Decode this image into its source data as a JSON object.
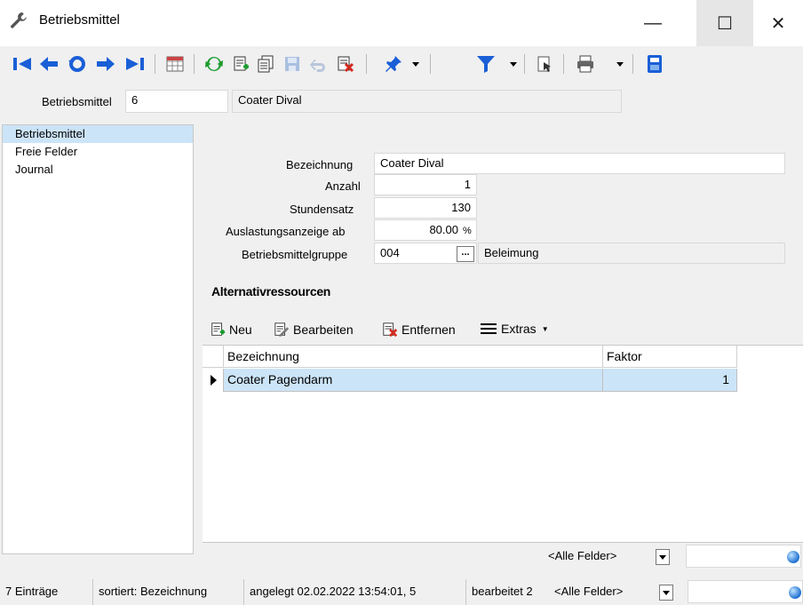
{
  "window": {
    "title": "Betriebsmittel",
    "minimize": "—",
    "maximize": "☐",
    "close": "✕"
  },
  "header": {
    "label": "Betriebsmittel",
    "number": "6",
    "name": "Coater Dival"
  },
  "nav": {
    "items": [
      "Betriebsmittel",
      "Freie Felder",
      "Journal"
    ],
    "selected": 0
  },
  "form": {
    "bezeichnung": {
      "label": "Bezeichnung",
      "value": "Coater Dival"
    },
    "anzahl": {
      "label": "Anzahl",
      "value": "1"
    },
    "stundensatz": {
      "label": "Stundensatz",
      "value": "130"
    },
    "auslastung": {
      "label": "Auslastungsanzeige ab",
      "value": "80.00",
      "unit": "%"
    },
    "gruppe": {
      "label": "Betriebsmittelgruppe",
      "code": "004",
      "button": "...",
      "name": "Beleimung"
    }
  },
  "alternatives": {
    "title": "Alternativressourcen",
    "toolbar": {
      "neu": "Neu",
      "bearbeiten": "Bearbeiten",
      "entfernen": "Entfernen",
      "extras": "Extras"
    },
    "columns": [
      "Bezeichnung",
      "Faktor"
    ],
    "rows": [
      {
        "bezeichnung": "Coater Pagendarm",
        "faktor": "1"
      }
    ],
    "filter": "<Alle Felder>"
  },
  "status": {
    "count": "7 Einträge",
    "sort": "sortiert: Bezeichnung",
    "created": "angelegt 02.02.2022 13:54:01, 5",
    "edited": "bearbeitet 2",
    "filter": "<Alle Felder>"
  },
  "colors": {
    "selection": "#cce4f7",
    "nav_icon_blue": "#1a5fd6",
    "refresh_green": "#1c9b2e",
    "delete_red": "#d42a1e"
  },
  "icons": [
    "wrench-icon",
    "first-record-icon",
    "previous-record-icon",
    "history-icon",
    "next-record-icon",
    "last-record-icon",
    "table-view-icon",
    "refresh-icon",
    "new-record-icon",
    "copy-record-icon",
    "save-icon",
    "undo-icon",
    "delete-icon",
    "pin-icon",
    "filter-icon",
    "export-icon",
    "print-icon",
    "calculator-icon"
  ]
}
